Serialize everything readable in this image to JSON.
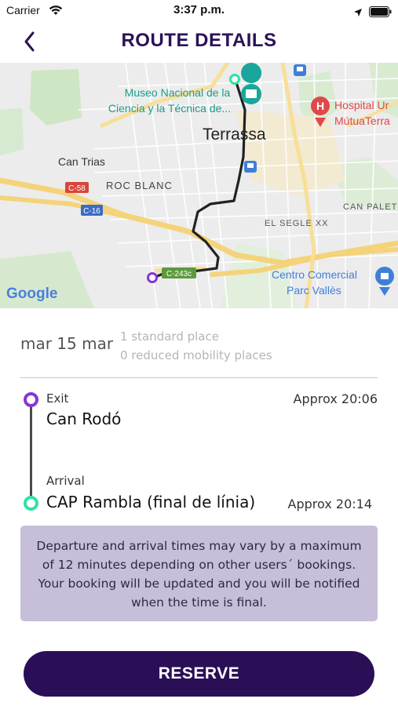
{
  "status_bar": {
    "carrier": "Carrier",
    "time": "3:37 p.m."
  },
  "header": {
    "title": "ROUTE DETAILS",
    "back_icon": "chevron-left-icon"
  },
  "map": {
    "labels": {
      "museum_line1": "Museo Nacional de la",
      "museum_line2": "Ciencia y la Técnica de...",
      "hospital_line1": "Hospital Ur",
      "hospital_line2": "MútuaTerra",
      "city": "Terrassa",
      "can_trias": "Can Trias",
      "roc_blanc": "ROC BLANC",
      "el_segle": "EL SEGLE XX",
      "can_palet": "CAN PALET",
      "mall_line1": "Centro Comercial",
      "mall_line2": "Parc Vallès",
      "road_c58": "C-58",
      "road_c16": "C-16",
      "road_c243c": "C-243c",
      "google": "Google"
    },
    "colors": {
      "route": "#222222",
      "origin": "#8a33d6",
      "destination": "#2ee3a2",
      "label_teal": "#1a9c8c",
      "hospital": "#e0484a",
      "poi_blue": "#3f7fd8"
    }
  },
  "booking": {
    "date": "mar 15 mar",
    "standard_places": "1 standard place",
    "reduced_places": "0 reduced mobility places"
  },
  "route": {
    "exit": {
      "caption": "Exit",
      "name": "Can Rodó",
      "time": "Approx 20:06"
    },
    "arrival": {
      "caption": "Arrival",
      "name": "CAP Rambla (final de línia)",
      "time": "Approx 20:14"
    }
  },
  "notice": {
    "text": "Departure and arrival times may vary by a maximum of 12 minutes depending on other users´ bookings. Your booking will be updated and you will be notified when the time is final."
  },
  "actions": {
    "reserve": "RESERVE"
  }
}
